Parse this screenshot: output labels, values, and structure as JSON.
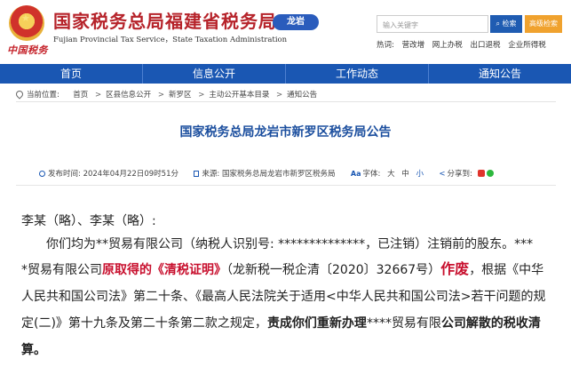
{
  "header": {
    "title": "国家税务总局福建省税务局",
    "subtitle": "Fujian Provincial Tax Service，State Taxation Administration",
    "city_badge": "龙岩",
    "brand_script": "中国税务",
    "search": {
      "placeholder": "输入关键字",
      "button": "检索",
      "advanced": "高级检索"
    },
    "hotwords": {
      "label": "热词:",
      "items": [
        "营改增",
        "网上办税",
        "出口退税",
        "企业所得税"
      ]
    }
  },
  "nav": {
    "items": [
      "首页",
      "信息公开",
      "工作动态",
      "通知公告"
    ]
  },
  "breadcrumb": {
    "label": "当前位置:",
    "items": [
      "首页",
      "区县信息公开",
      "新罗区",
      "主动公开基本目录",
      "通知公告"
    ]
  },
  "article": {
    "title": "国家税务总局龙岩市新罗区税务局公告",
    "meta": {
      "publish_label": "发布时间:",
      "publish_time": "2024年04月22日09时51分",
      "source_label": "来源:",
      "source": "国家税务总局龙岩市新罗区税务局",
      "font_label": "字体:",
      "font_sizes": [
        "大",
        "中",
        "小"
      ],
      "share_label": "分享到:"
    },
    "body": {
      "salutation": "李某（略）、李某（略）:",
      "p1_line1": "你们均为**贸易有限公司（纳税人识别号: **************，已注销）注销前的股东。***",
      "p1_line2_a": "*贸易有限公司",
      "p1_line2_red": "原取得的《清税证明》",
      "p1_line2_b": "（龙新税一税企清〔2020〕32667号）",
      "p1_line2_void": "作废",
      "p1_line2_c": "，根据《中华",
      "p1_line3": "人民共和国公司法》第二十条、《最高人民法院关于适用<中华人民共和国公司法>若干问题的规",
      "p1_line4_a": "定(二)》第十九条及第二十条第二款之规定，",
      "p1_line4_b": "责成你们重新办理",
      "p1_line4_c": "****贸易有限",
      "p1_line4_d": "公司解散的税收清",
      "p1_line5": "算。"
    }
  }
}
